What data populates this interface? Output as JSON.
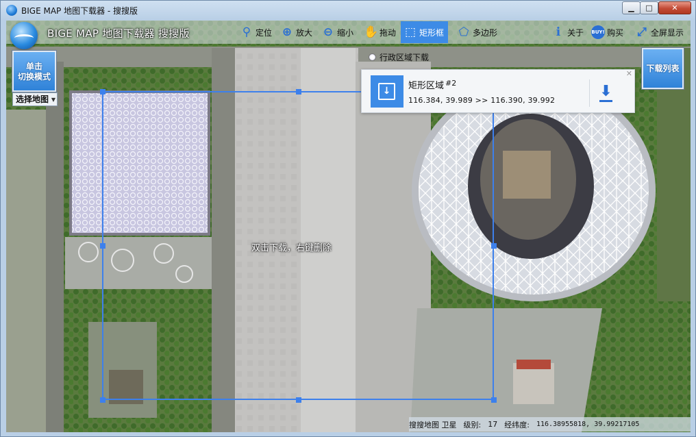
{
  "window": {
    "title": "BIGE MAP 地图下载器 - 搜搜版",
    "minimize_label": "▁",
    "maximize_label": "□",
    "close_label": "✕"
  },
  "toolbar": {
    "app_name": "BIGE MAP 地图下载器 搜搜版",
    "items": [
      {
        "label": "定位",
        "icon": "location-pin-icon",
        "glyph": "⚲"
      },
      {
        "label": "放大",
        "icon": "zoom-in-icon",
        "glyph": "⊕"
      },
      {
        "label": "缩小",
        "icon": "zoom-out-icon",
        "glyph": "⊖"
      },
      {
        "label": "拖动",
        "icon": "hand-icon",
        "glyph": "✋"
      },
      {
        "label": "矩形框",
        "icon": "rectangle-select-icon",
        "glyph": "⬚",
        "active": true
      },
      {
        "label": "多边形",
        "icon": "polygon-icon",
        "glyph": "⬠"
      },
      {
        "label": "关于",
        "icon": "info-icon",
        "glyph": "ℹ"
      },
      {
        "label": "购买",
        "icon": "buy-icon",
        "glyph": "BUY!"
      },
      {
        "label": "全屏显示",
        "icon": "fullscreen-icon",
        "glyph": "⤢"
      }
    ],
    "accent_color": "#3d8be6"
  },
  "left_panel": {
    "mode_button_line1": "单击",
    "mode_button_line2": "切换模式",
    "choose_map_label": "选择地图"
  },
  "right_panel": {
    "download_list_label": "下载列表"
  },
  "admin_download": {
    "label": "行政区域下载"
  },
  "region_card": {
    "name": "矩形区域",
    "id": "#2",
    "coords": "116.384, 39.989 >> 116.390, 39.992",
    "close_label": "✕"
  },
  "selection": {
    "hint": "双击下载，右键删除",
    "color": "#3d80ec"
  },
  "status_bar": {
    "map_source": "搜搜地图 卫星",
    "level_label": "级别:",
    "level_value": "17",
    "latlon_label": "经纬度:",
    "latlon_value": "116.38955818, 39.99217105"
  }
}
